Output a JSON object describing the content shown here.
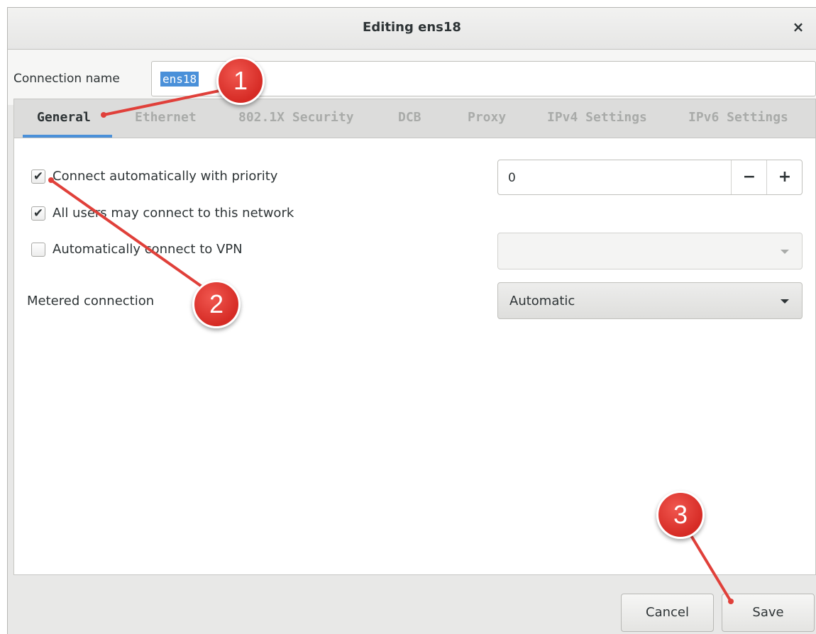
{
  "window": {
    "title": "Editing ens18",
    "close_label": "×"
  },
  "connection": {
    "name_label": "Connection name",
    "name_value": "ens18"
  },
  "tabs": [
    {
      "label": "General",
      "active": true
    },
    {
      "label": "Ethernet"
    },
    {
      "label": "802.1X Security"
    },
    {
      "label": "DCB"
    },
    {
      "label": "Proxy"
    },
    {
      "label": "IPv4 Settings"
    },
    {
      "label": "IPv6 Settings"
    }
  ],
  "general": {
    "auto_connect": {
      "label": "Connect automatically with priority",
      "checked": true,
      "check_glyph": "✔"
    },
    "all_users": {
      "label": "All users may connect to this network",
      "checked": true,
      "check_glyph": "✔"
    },
    "auto_vpn": {
      "label": "Automatically connect to VPN",
      "checked": false
    },
    "priority_value": "0",
    "minus_label": "−",
    "plus_label": "+",
    "vpn_selected": "",
    "metered_label": "Metered connection",
    "metered_value": "Automatic"
  },
  "buttons": {
    "cancel": "Cancel",
    "save": "Save"
  },
  "annotations": {
    "badge1": "1",
    "badge2": "2",
    "badge3": "3",
    "color": "#d62b25"
  }
}
